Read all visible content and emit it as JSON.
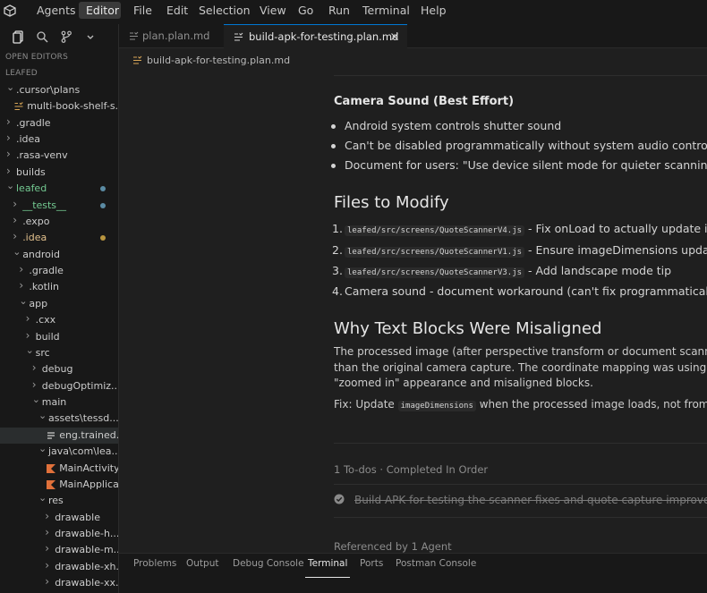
{
  "menubar": {
    "items": [
      "Agents",
      "Editor",
      "File",
      "Edit",
      "Selection",
      "View",
      "Go",
      "Run",
      "Terminal",
      "Help"
    ]
  },
  "sidebar": {
    "open_editors": "OPEN EDITORS",
    "root": "LEAFED",
    "tree": [
      {
        "label": ".cursor\\plans",
        "indent": 0,
        "expanded": true,
        "kind": "folder"
      },
      {
        "label": "multi-book-shelf-s...",
        "indent": 1,
        "kind": "plan"
      },
      {
        "label": ".gradle",
        "indent": 0,
        "kind": "folder"
      },
      {
        "label": ".idea",
        "indent": 0,
        "kind": "folder"
      },
      {
        "label": ".rasa-venv",
        "indent": 0,
        "kind": "folder"
      },
      {
        "label": "builds",
        "indent": 0,
        "kind": "folder"
      },
      {
        "label": "leafed",
        "indent": 0,
        "expanded": true,
        "kind": "folder",
        "color": "green",
        "dot": "#5b8ba3"
      },
      {
        "label": "__tests__",
        "indent": 1,
        "kind": "folder",
        "color": "green",
        "dot": "#5b8ba3"
      },
      {
        "label": ".expo",
        "indent": 1,
        "kind": "folder"
      },
      {
        "label": ".idea",
        "indent": 1,
        "kind": "folder",
        "color": "yellow",
        "dot": "#b8953f"
      },
      {
        "label": "android",
        "indent": 1,
        "expanded": true,
        "kind": "folder"
      },
      {
        "label": ".gradle",
        "indent": 2,
        "kind": "folder"
      },
      {
        "label": ".kotlin",
        "indent": 2,
        "kind": "folder"
      },
      {
        "label": "app",
        "indent": 2,
        "expanded": true,
        "kind": "folder"
      },
      {
        "label": ".cxx",
        "indent": 3,
        "kind": "folder"
      },
      {
        "label": "build",
        "indent": 3,
        "kind": "folder"
      },
      {
        "label": "src",
        "indent": 3,
        "expanded": true,
        "kind": "folder"
      },
      {
        "label": "debug",
        "indent": 4,
        "kind": "folder"
      },
      {
        "label": "debugOptimiz...",
        "indent": 4,
        "kind": "folder"
      },
      {
        "label": "main",
        "indent": 4,
        "expanded": true,
        "kind": "folder"
      },
      {
        "label": "assets\\tessd...",
        "indent": 5,
        "expanded": true,
        "kind": "folder"
      },
      {
        "label": "eng.trained...",
        "indent": 6,
        "kind": "text",
        "selected": true
      },
      {
        "label": "java\\com\\lea...",
        "indent": 5,
        "expanded": true,
        "kind": "folder"
      },
      {
        "label": "MainActivity...",
        "indent": 6,
        "kind": "kotlin"
      },
      {
        "label": "MainApplica...",
        "indent": 6,
        "kind": "kotlin"
      },
      {
        "label": "res",
        "indent": 5,
        "expanded": true,
        "kind": "folder"
      },
      {
        "label": "drawable",
        "indent": 6,
        "kind": "folder"
      },
      {
        "label": "drawable-h...",
        "indent": 6,
        "kind": "folder"
      },
      {
        "label": "drawable-m...",
        "indent": 6,
        "kind": "folder"
      },
      {
        "label": "drawable-xh...",
        "indent": 6,
        "kind": "folder"
      },
      {
        "label": "drawable-xx...",
        "indent": 6,
        "kind": "folder"
      }
    ]
  },
  "tabs": [
    {
      "label": "plan.plan.md",
      "active": false
    },
    {
      "label": "build-apk-for-testing.plan.md",
      "active": true
    }
  ],
  "breadcrumb": "build-apk-for-testing.plan.md",
  "doc": {
    "camera_heading": "Camera Sound (Best Effort)",
    "camera_bullets": [
      "Android system controls shutter sound",
      "Can't be disabled programmatically without system audio control",
      "Document for users: \"Use device silent mode for quieter scanning\""
    ],
    "files_heading": "Files to Modify",
    "files": [
      {
        "num": "1.",
        "code": "leafed/src/screens/QuoteScannerV4.js",
        "text": " - Fix onLoad to actually update image"
      },
      {
        "num": "2.",
        "code": "leafed/src/screens/QuoteScannerV1.js",
        "text": " - Ensure imageDimensions updates c"
      },
      {
        "num": "3.",
        "code": "leafed/src/screens/QuoteScannerV3.js",
        "text": " - Add landscape mode tip"
      },
      {
        "num": "4.",
        "code": "",
        "text": "Camera sound - document workaround (can't fix programmatically)"
      }
    ],
    "why_heading": "Why Text Blocks Were Misaligned",
    "why_lines": [
      "The processed image (after perspective transform or document scanne",
      "than the original camera capture. The coordinate mapping was using th",
      "\"zoomed in\" appearance and misaligned blocks."
    ],
    "fix_prefix": "Fix: Update ",
    "fix_code": "imageDimensions",
    "fix_suffix": " when the processed image loads, not from th",
    "todos_header": "1 To-dos · Completed In Order",
    "todo_item": "Build APK for testing the scanner fixes and quote capture improvem",
    "referenced": "Referenced by 1 Agent"
  },
  "panel": {
    "tabs": [
      "Problems",
      "Output",
      "Debug Console",
      "Terminal",
      "Ports",
      "Postman Console"
    ]
  }
}
